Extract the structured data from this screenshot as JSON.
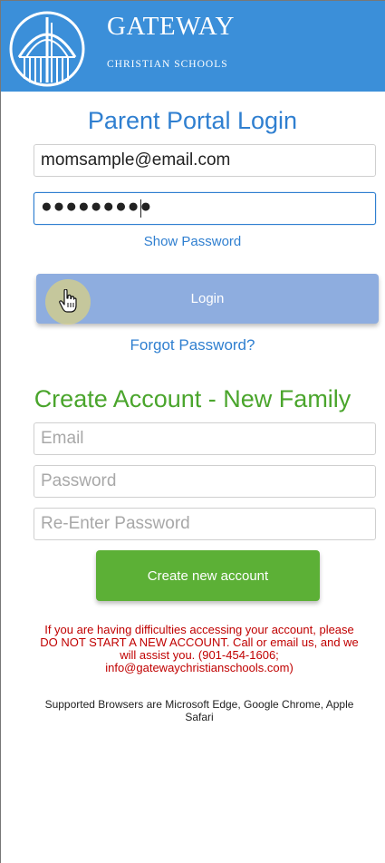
{
  "brand": {
    "title": "GATEWAY",
    "subtitle": "CHRISTIAN SCHOOLS",
    "header_color": "#3b8fd9"
  },
  "login": {
    "title": "Parent Portal Login",
    "email_value": "momsample@email.com",
    "password_masked": "●●●●●●●●●",
    "show_password": "Show Password",
    "button": "Login",
    "forgot": "Forgot Password?"
  },
  "create": {
    "title": "Create Account - New Family",
    "email_placeholder": "Email",
    "password_placeholder": "Password",
    "repassword_placeholder": "Re-Enter Password",
    "button": "Create new account"
  },
  "notice": {
    "warning": "If you are having difficulties accessing your account, please\nDO NOT START A NEW ACCOUNT. Call or email us, and we\nwill assist you. (901-454-1606;\ninfo@gatewaychristianschools.com)",
    "browsers": "Supported Browsers are Microsoft Edge, Google Chrome, Apple\nSafari"
  },
  "colors": {
    "link_blue": "#2f7fd0",
    "green": "#4aa52c",
    "warning_red": "#c00000"
  },
  "icons": {
    "logo": "gateway-arch-logo-icon",
    "cursor": "hand-pointer-icon"
  }
}
